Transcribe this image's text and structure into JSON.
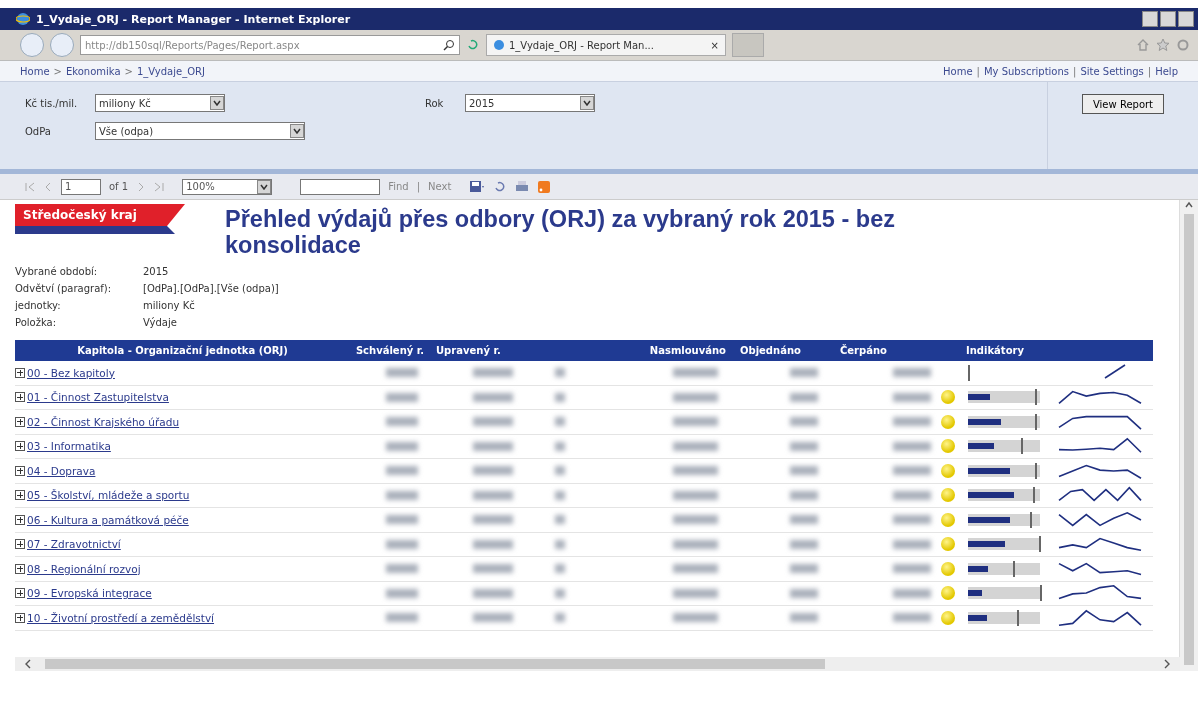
{
  "window": {
    "title": "1_Vydaje_ORJ - Report Manager - Internet Explorer"
  },
  "address_bar": {
    "url": "http://db150sql/Reports/Pages/Report.aspx"
  },
  "browser_tab": {
    "label": "1_Vydaje_ORJ - Report Man...",
    "close": "×"
  },
  "breadcrumb": [
    "Home",
    "Ekonomika",
    "1_Vydaje_ORJ"
  ],
  "breadcrumb_separator": ">",
  "top_links": [
    "Home",
    "My Subscriptions",
    "Site Settings",
    "Help"
  ],
  "top_links_separator": "|",
  "parameters": [
    {
      "label": "Kč tis./mil.",
      "value": "miliony Kč"
    },
    {
      "label": "Rok",
      "value": "2015"
    },
    {
      "label": "OdPa",
      "value": "Vše (odpa)"
    }
  ],
  "view_report_button": "View Report",
  "toolbar": {
    "page": "1",
    "of_pages": "of 1",
    "zoom": "100%",
    "find": "Find",
    "separator": "|",
    "next": "Next"
  },
  "report": {
    "logo": "Středočeský kraj",
    "title": "Přehled výdajů přes odbory (ORJ) za vybraný rok 2015 - bez konsolidace",
    "info": [
      {
        "label": "Vybrané období:",
        "value": "2015"
      },
      {
        "label": "Odvětví (paragraf):",
        "value": "[OdPa].[OdPa].[Vše (odpa)]"
      },
      {
        "label": "jednotky:",
        "value": "miliony Kč"
      },
      {
        "label": "Položka:",
        "value": "Výdaje"
      }
    ]
  },
  "table": {
    "columns": [
      "Kapitola - Organizační jednotka (ORJ)",
      "Schválený r.",
      "Upravený r.",
      "Nasmlouváno",
      "Objednáno",
      "Čerpáno",
      "Indikátory"
    ],
    "rows": [
      {
        "name": "00 - Bez kapitoly",
        "status_dot": false,
        "bar": {
          "kind": "marker"
        }
      },
      {
        "name": "01 - Činnost Zastupitelstva",
        "status_dot": true,
        "bar": {
          "level": 0.3,
          "target": {
            "level": 0.93
          }
        }
      },
      {
        "name": "02 - Činnost Krajského úřadu",
        "status_dot": true,
        "bar": {
          "level": 0.46,
          "target": {
            "level": 0.93
          }
        }
      },
      {
        "name": "03 - Informatika",
        "status_dot": true,
        "bar": {
          "level": 0.36,
          "target": {
            "level": 0.73
          }
        }
      },
      {
        "name": "04 - Doprava",
        "status_dot": true,
        "bar": {
          "level": 0.58,
          "target": {
            "level": 0.93
          }
        }
      },
      {
        "name": "05 - Školství, mládeže a sportu",
        "status_dot": true,
        "bar": {
          "level": 0.64,
          "target": {
            "level": 0.9
          }
        }
      },
      {
        "name": "06 - Kultura a památková péče",
        "status_dot": true,
        "bar": {
          "level": 0.58,
          "target": {
            "level": 0.86
          }
        }
      },
      {
        "name": "07 - Zdravotnictví",
        "status_dot": true,
        "bar": {
          "level": 0.51,
          "target": {
            "level": 0.98
          }
        }
      },
      {
        "name": "08 - Regionální rozvoj",
        "status_dot": true,
        "bar": {
          "level": 0.28,
          "target": {
            "level": 0.62
          }
        }
      },
      {
        "name": "09 - Evropská integrace",
        "status_dot": true,
        "bar": {
          "level": 0.2,
          "target": {
            "level": 1
          }
        }
      },
      {
        "name": "10 - Životní prostředí a zemědělství",
        "status_dot": true,
        "bar": {
          "level": 0.26,
          "target": {
            "level": 0.68
          }
        }
      }
    ]
  }
}
